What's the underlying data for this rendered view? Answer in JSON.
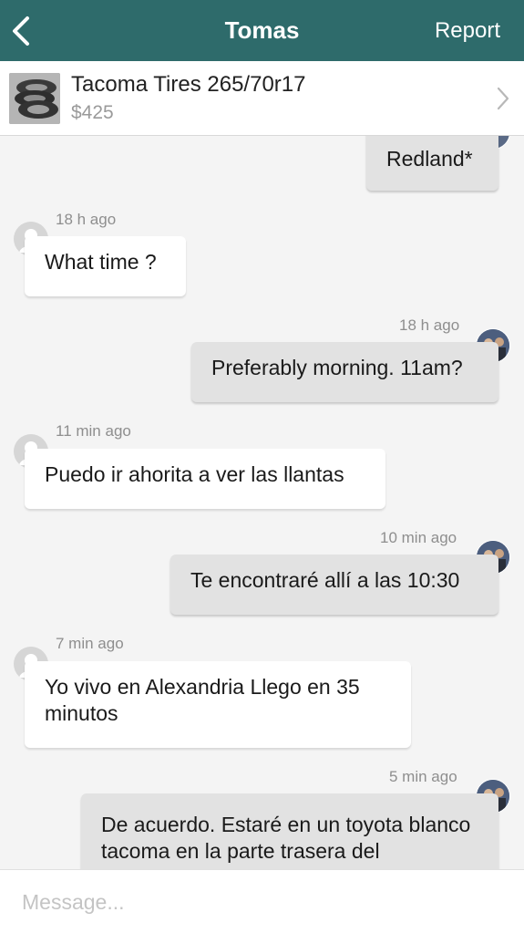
{
  "header": {
    "title": "Tomas",
    "report_label": "Report"
  },
  "listing": {
    "title": "Tacoma Tires 265/70r17",
    "price": "$425"
  },
  "messages": [
    {
      "direction": "out",
      "time": "",
      "text": "Redland*"
    },
    {
      "direction": "in",
      "time": "18 h ago",
      "text": "What time ?"
    },
    {
      "direction": "out",
      "time": "18 h ago",
      "text": "Preferably morning. 11am?"
    },
    {
      "direction": "in",
      "time": "11 min ago",
      "text": "Puedo ir ahorita a ver las llantas"
    },
    {
      "direction": "out",
      "time": "10 min ago",
      "text": "Te encontraré allí a las 10:30"
    },
    {
      "direction": "in",
      "time": "7 min ago",
      "text": "Yo vivo en Alexandria Llego en 35 minutos"
    },
    {
      "direction": "out",
      "time": "5 min ago",
      "text": "De acuerdo. Estaré en un toyota blanco tacoma en la parte trasera del"
    }
  ],
  "composer": {
    "placeholder": "Message..."
  },
  "colors": {
    "header_bg": "#2e6b6b",
    "incoming_bubble": "#ffffff",
    "outgoing_bubble": "#e2e2e2"
  }
}
